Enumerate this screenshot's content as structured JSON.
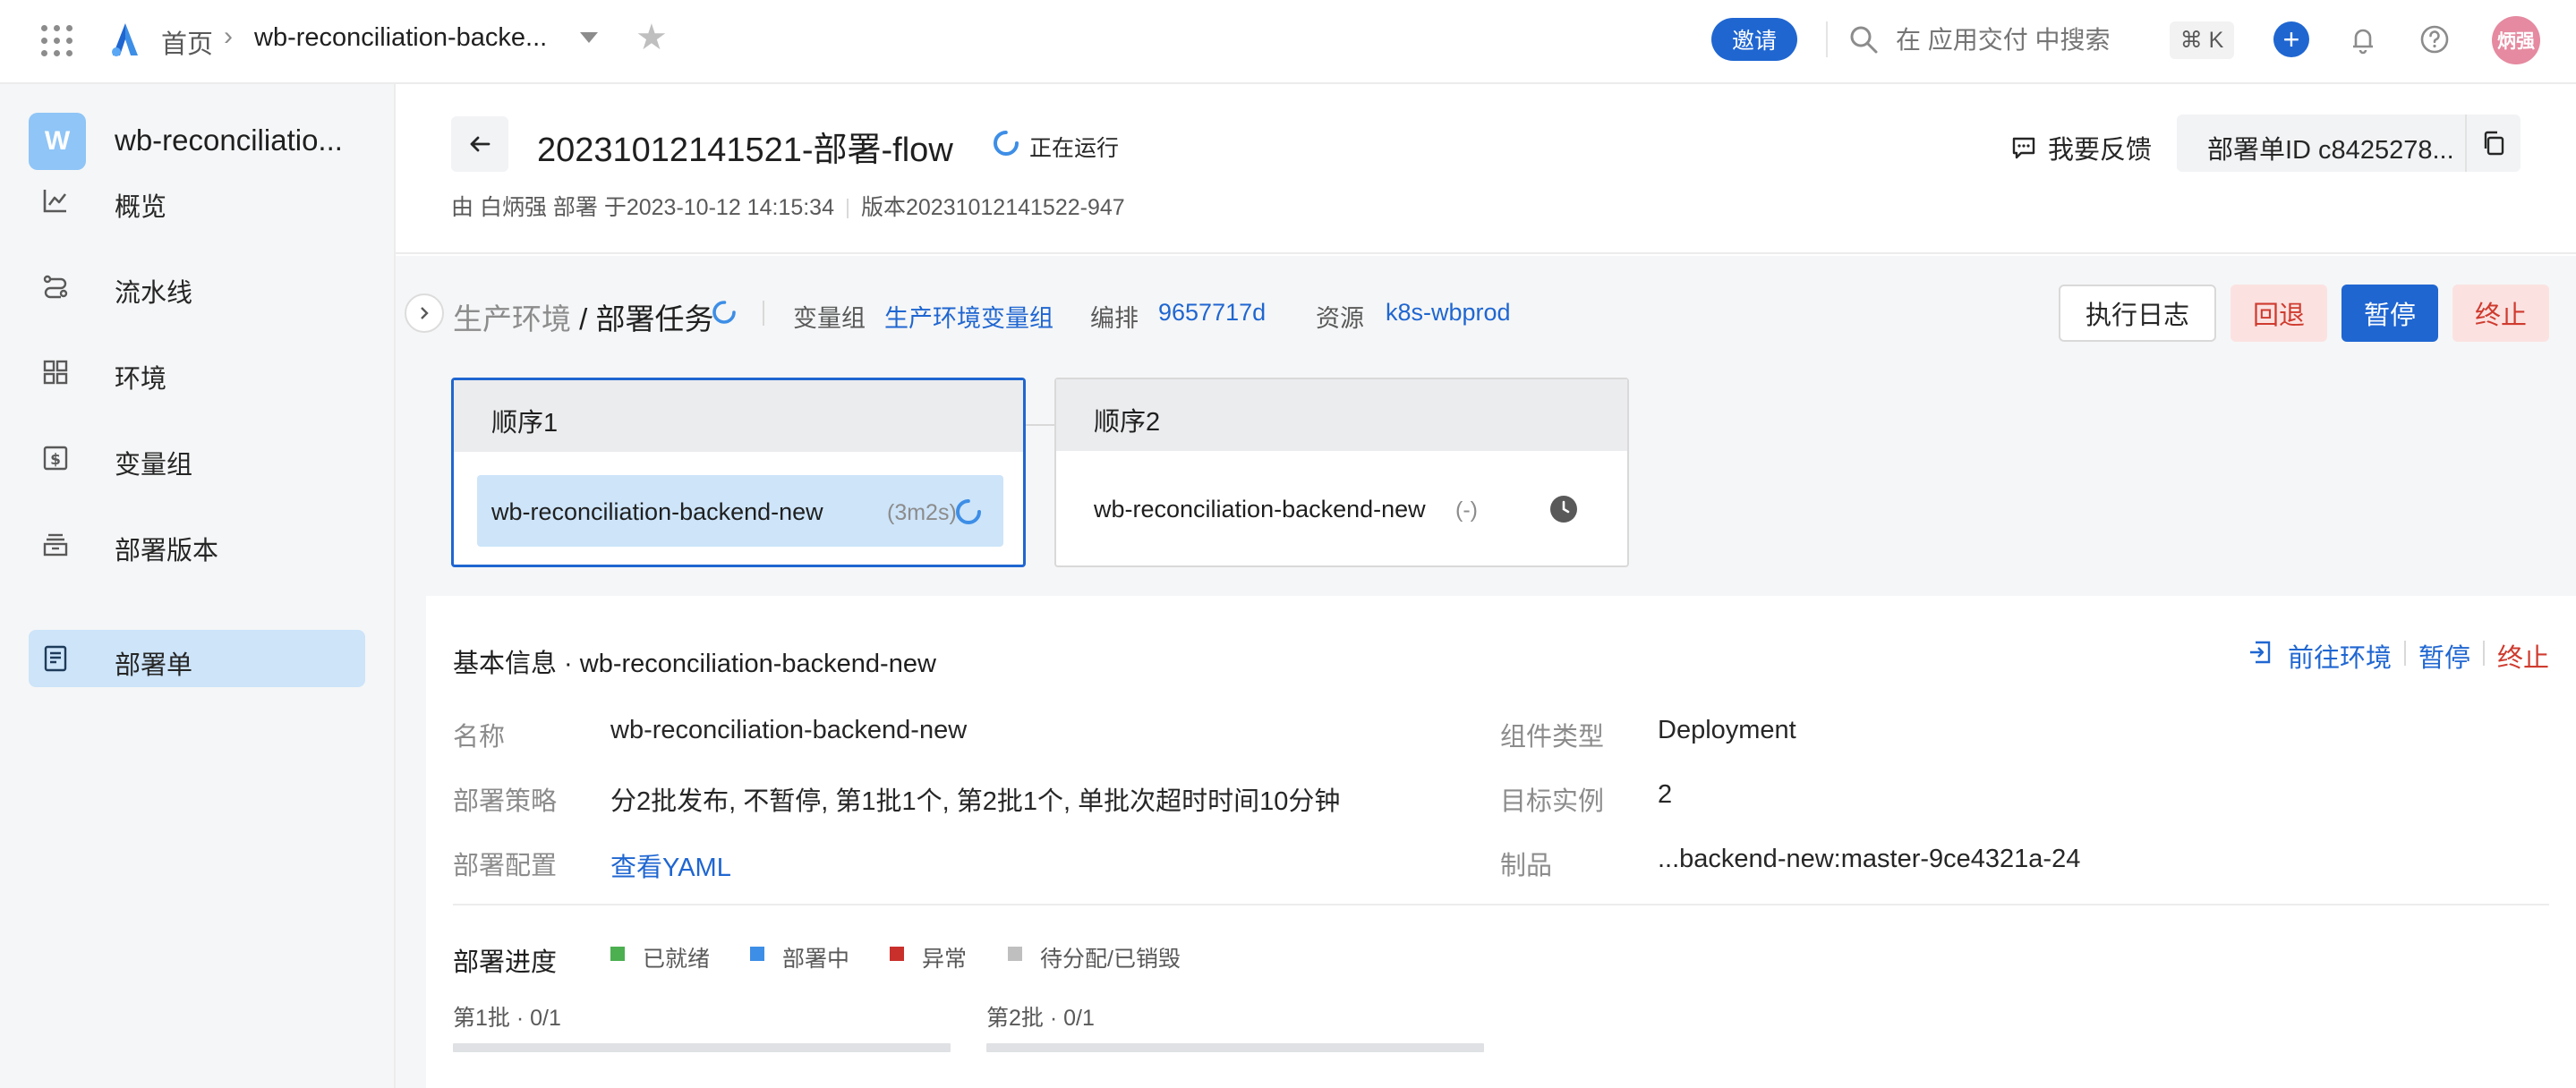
{
  "topbar": {
    "home": "首页",
    "app": "wb-reconciliation-backe...",
    "invite": "邀请",
    "search_placeholder": "在 应用交付 中搜索",
    "shortcut": "⌘ K",
    "plus": "+",
    "user": "炳强"
  },
  "sidebar": {
    "badge": "W",
    "app_name": "wb-reconciliatio...",
    "items": [
      {
        "label": "概览",
        "icon": "chart-line-icon"
      },
      {
        "label": "流水线",
        "icon": "pipeline-icon"
      },
      {
        "label": "环境",
        "icon": "grid-icon"
      },
      {
        "label": "变量组",
        "icon": "dollar-box-icon"
      },
      {
        "label": "部署版本",
        "icon": "archive-icon"
      },
      {
        "label": "部署单",
        "icon": "document-icon",
        "active": true
      }
    ]
  },
  "header": {
    "title": "20231012141521-部署-flow",
    "status": "正在运行",
    "meta_by": "由 白炳强 部署 于2023-10-12 14:15:34",
    "meta_version": "版本20231012141522-947",
    "feedback": "我要反馈",
    "deploy_id": "部署单ID c8425278..."
  },
  "stage": {
    "env": "生产环境",
    "task": "/ 部署任务",
    "var_label": "变量组",
    "var_value": "生产环境变量组",
    "arrange_label": "编排",
    "arrange_value": "9657717d",
    "resource_label": "资源",
    "resource_value": "k8s-wbprod",
    "buttons": {
      "log": "执行日志",
      "rollback": "回退",
      "pause": "暂停",
      "stop": "终止"
    }
  },
  "sequences": [
    {
      "title": "顺序1",
      "job": "wb-reconciliation-backend-new",
      "time": "(3m2s)",
      "status": "running"
    },
    {
      "title": "顺序2",
      "job": "wb-reconciliation-backend-new",
      "time": "(-)",
      "status": "pending"
    }
  ],
  "detail": {
    "title": "基本信息 · wb-reconciliation-backend-new",
    "actions": {
      "goto": "前往环境",
      "pause": "暂停",
      "stop": "终止"
    },
    "left": [
      {
        "label": "名称",
        "value": "wb-reconciliation-backend-new"
      },
      {
        "label": "部署策略",
        "value": "分2批发布, 不暂停, 第1批1个, 第2批1个, 单批次超时时间10分钟"
      },
      {
        "label": "部署配置",
        "value": "查看YAML"
      }
    ],
    "right": [
      {
        "label": "组件类型",
        "value": "Deployment"
      },
      {
        "label": "目标实例",
        "value": "2"
      },
      {
        "label": "制品",
        "value": "...backend-new:master-9ce4321a-24"
      }
    ]
  },
  "progress": {
    "title": "部署进度",
    "legend": [
      {
        "label": "已就绪",
        "color": "#4caf50"
      },
      {
        "label": "部署中",
        "color": "#3d8ee6"
      },
      {
        "label": "异常",
        "color": "#c9302c"
      },
      {
        "label": "待分配/已销毁",
        "color": "#bfbfbf"
      }
    ],
    "batches": [
      {
        "label": "第1批 · 0/1",
        "fraction": 0
      },
      {
        "label": "第2批 · 0/1",
        "fraction": 0
      }
    ]
  },
  "colors": {
    "accent": "#1f66d1",
    "danger": "#cf3b2f",
    "active_bg": "#cde4f9"
  }
}
